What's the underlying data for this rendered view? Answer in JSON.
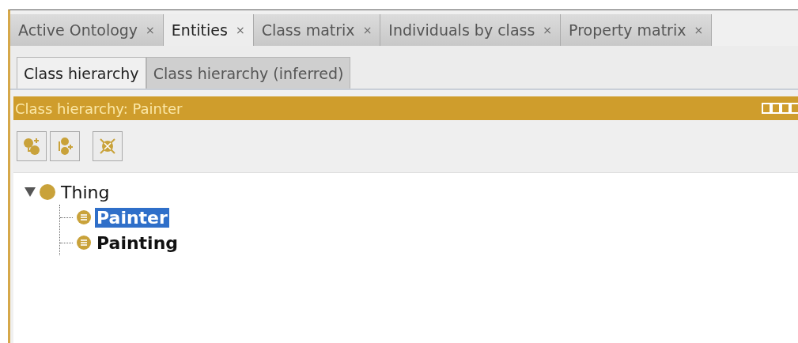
{
  "tabs": [
    {
      "label": "Active Ontology",
      "close": "×",
      "selected": false
    },
    {
      "label": "Entities",
      "close": "×",
      "selected": true
    },
    {
      "label": "Class matrix",
      "close": "×",
      "selected": false
    },
    {
      "label": "Individuals by class",
      "close": "×",
      "selected": false
    },
    {
      "label": "Property matrix",
      "close": "×",
      "selected": false
    }
  ],
  "subtabs": [
    {
      "label": "Class hierarchy",
      "selected": true
    },
    {
      "label": "Class hierarchy (inferred)",
      "selected": false
    }
  ],
  "view": {
    "title": "Class hierarchy: Painter"
  },
  "tree": [
    {
      "label": "Thing",
      "kind": "root",
      "expanded": true,
      "selected": false,
      "children": [
        {
          "label": "Painter",
          "kind": "class",
          "selected": true
        },
        {
          "label": "Painting",
          "kind": "class",
          "selected": false
        }
      ]
    }
  ]
}
